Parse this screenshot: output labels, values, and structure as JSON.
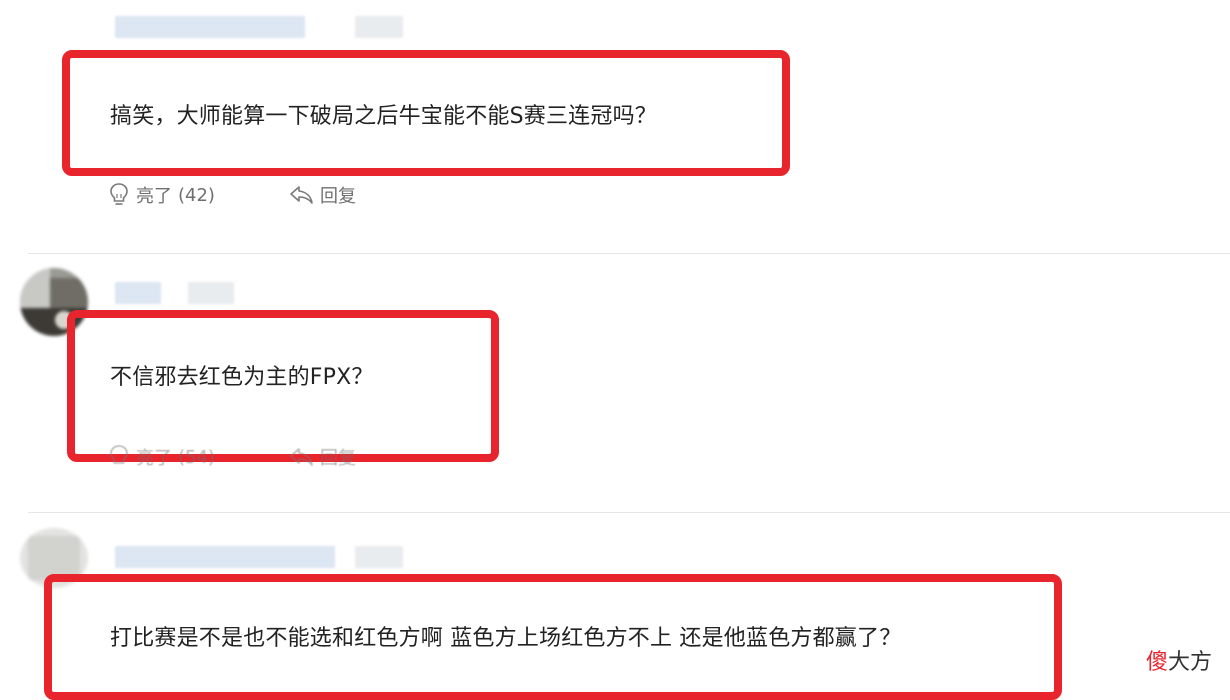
{
  "comments": [
    {
      "text": "搞笑，大师能算一下破局之后牛宝能不能S赛三连冠吗？",
      "like_label": "亮了",
      "like_count": "(42)",
      "reply_label": "回复"
    },
    {
      "text": "不信邪去红色为主的FPX？",
      "like_label": "亮了",
      "like_count": "(54)",
      "reply_label": "回复"
    },
    {
      "text": "打比赛是不是也不能选和红色方啊 蓝色方上场红色方不上 还是他蓝色方都赢了？"
    }
  ],
  "watermark": {
    "accent": "傻",
    "rest": "大方"
  },
  "colors": {
    "highlight_red": "#e8242c",
    "text": "#222222",
    "muted": "#6f6f6f"
  }
}
